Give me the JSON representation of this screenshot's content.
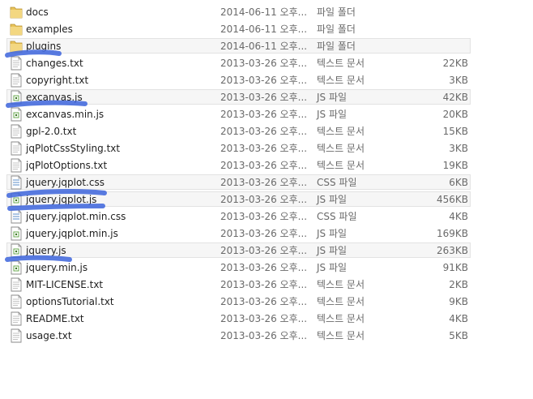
{
  "files": [
    {
      "name": "docs",
      "date": "2014-06-11 오후...",
      "type": "파일 폴더",
      "size": "",
      "icon": "folder-icon",
      "selected": false
    },
    {
      "name": "examples",
      "date": "2014-06-11 오후...",
      "type": "파일 폴더",
      "size": "",
      "icon": "folder-icon",
      "selected": false
    },
    {
      "name": "plugins",
      "date": "2014-06-11 오후...",
      "type": "파일 폴더",
      "size": "",
      "icon": "folder-icon",
      "selected": true
    },
    {
      "name": "changes.txt",
      "date": "2013-03-26 오후...",
      "type": "텍스트 문서",
      "size": "22KB",
      "icon": "text-file-icon",
      "selected": false
    },
    {
      "name": "copyright.txt",
      "date": "2013-03-26 오후...",
      "type": "텍스트 문서",
      "size": "3KB",
      "icon": "text-file-icon",
      "selected": false
    },
    {
      "name": "excanvas.js",
      "date": "2013-03-26 오후...",
      "type": "JS 파일",
      "size": "42KB",
      "icon": "js-file-icon",
      "selected": true
    },
    {
      "name": "excanvas.min.js",
      "date": "2013-03-26 오후...",
      "type": "JS 파일",
      "size": "20KB",
      "icon": "js-file-icon",
      "selected": false
    },
    {
      "name": "gpl-2.0.txt",
      "date": "2013-03-26 오후...",
      "type": "텍스트 문서",
      "size": "15KB",
      "icon": "text-file-icon",
      "selected": false
    },
    {
      "name": "jqPlotCssStyling.txt",
      "date": "2013-03-26 오후...",
      "type": "텍스트 문서",
      "size": "3KB",
      "icon": "text-file-icon",
      "selected": false
    },
    {
      "name": "jqPlotOptions.txt",
      "date": "2013-03-26 오후...",
      "type": "텍스트 문서",
      "size": "19KB",
      "icon": "text-file-icon",
      "selected": false
    },
    {
      "name": "jquery.jqplot.css",
      "date": "2013-03-26 오후...",
      "type": "CSS 파일",
      "size": "6KB",
      "icon": "css-file-icon",
      "selected": true
    },
    {
      "name": "jquery.jqplot.js",
      "date": "2013-03-26 오후...",
      "type": "JS 파일",
      "size": "456KB",
      "icon": "js-file-icon",
      "selected": true
    },
    {
      "name": "jquery.jqplot.min.css",
      "date": "2013-03-26 오후...",
      "type": "CSS 파일",
      "size": "4KB",
      "icon": "css-file-icon",
      "selected": false
    },
    {
      "name": "jquery.jqplot.min.js",
      "date": "2013-03-26 오후...",
      "type": "JS 파일",
      "size": "169KB",
      "icon": "js-file-icon",
      "selected": false
    },
    {
      "name": "jquery.js",
      "date": "2013-03-26 오후...",
      "type": "JS 파일",
      "size": "263KB",
      "icon": "js-file-icon",
      "selected": true
    },
    {
      "name": "jquery.min.js",
      "date": "2013-03-26 오후...",
      "type": "JS 파일",
      "size": "91KB",
      "icon": "js-file-icon",
      "selected": false
    },
    {
      "name": "MIT-LICENSE.txt",
      "date": "2013-03-26 오후...",
      "type": "텍스트 문서",
      "size": "2KB",
      "icon": "text-file-icon",
      "selected": false
    },
    {
      "name": "optionsTutorial.txt",
      "date": "2013-03-26 오후...",
      "type": "텍스트 문서",
      "size": "9KB",
      "icon": "text-file-icon",
      "selected": false
    },
    {
      "name": "README.txt",
      "date": "2013-03-26 오후...",
      "type": "텍스트 문서",
      "size": "4KB",
      "icon": "text-file-icon",
      "selected": false
    },
    {
      "name": "usage.txt",
      "date": "2013-03-26 오후...",
      "type": "텍스트 문서",
      "size": "5KB",
      "icon": "text-file-icon",
      "selected": false
    }
  ],
  "colors": {
    "highlight_stroke": "#3c64dc",
    "folder": "#e8c35a",
    "selection_bg": "#f6f6f6"
  }
}
